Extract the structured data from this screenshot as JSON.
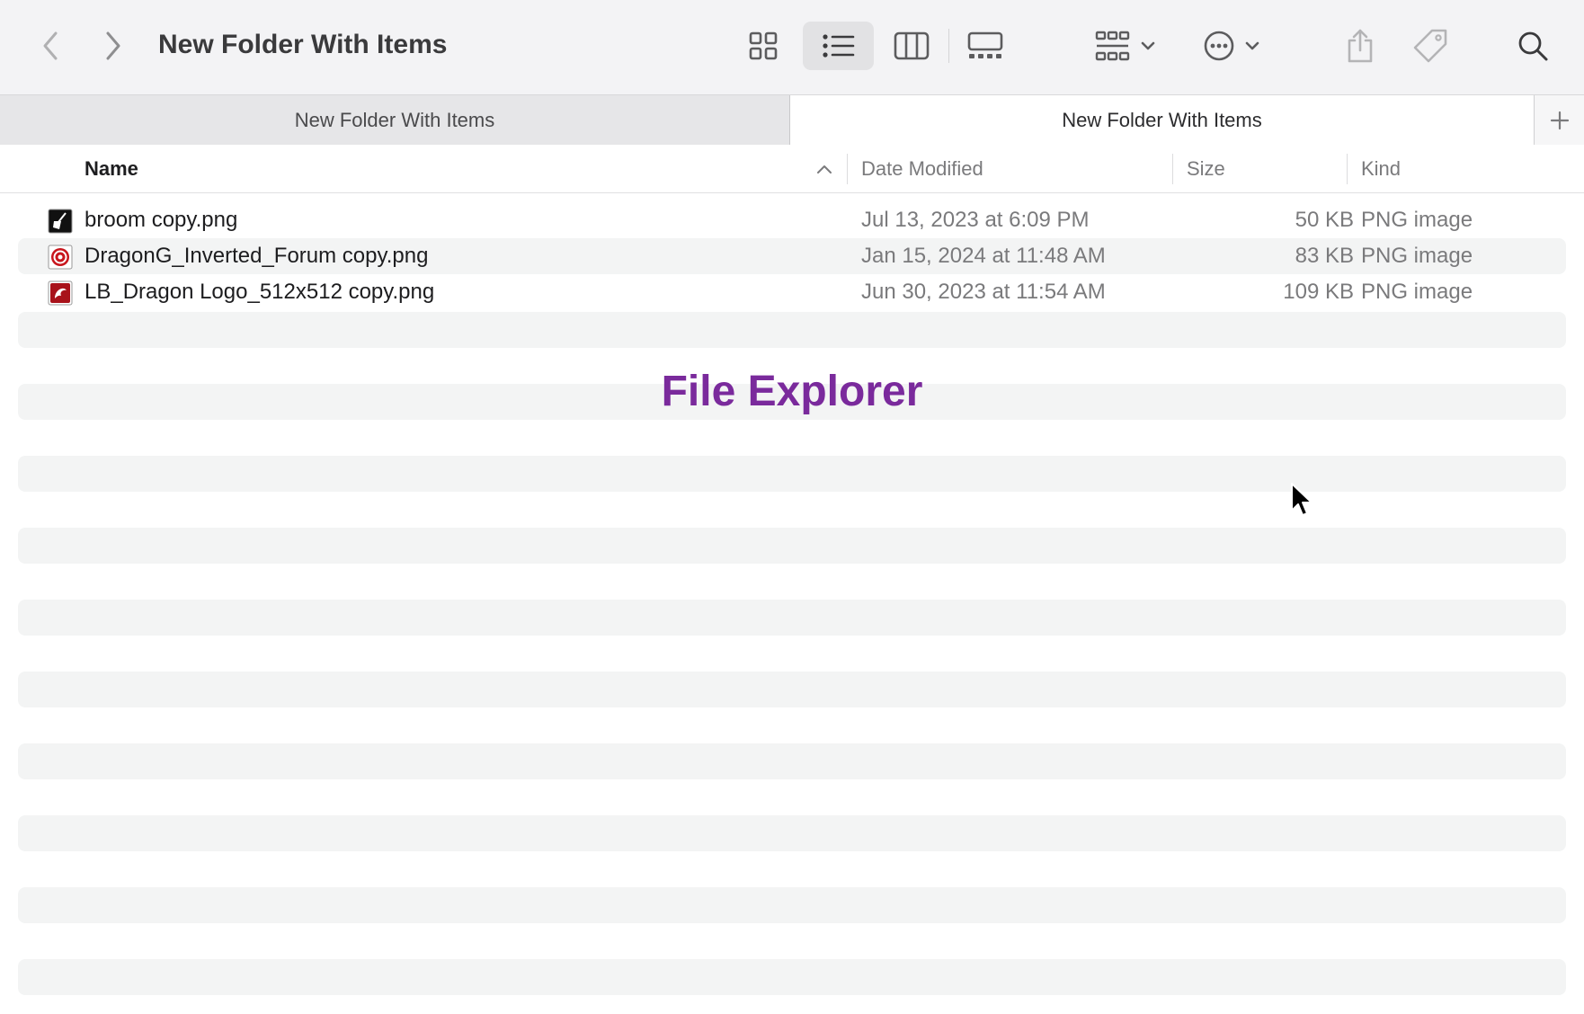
{
  "window": {
    "title": "New Folder With Items"
  },
  "toolbar": {
    "icons": [
      "chevron-left-icon",
      "chevron-right-icon",
      "grid-view-icon",
      "list-view-icon",
      "column-view-icon",
      "gallery-view-icon",
      "group-icon",
      "more-icon",
      "share-icon",
      "tag-icon",
      "search-icon"
    ],
    "selected_view": "list"
  },
  "tabs": [
    {
      "label": "New Folder With Items",
      "active": false
    },
    {
      "label": "New Folder With Items",
      "active": true
    }
  ],
  "columns": {
    "name": "Name",
    "date": "Date Modified",
    "size": "Size",
    "kind": "Kind"
  },
  "files": [
    {
      "name": "broom copy.png",
      "date": "Jul 13, 2023 at 6:09 PM",
      "size": "50 KB",
      "kind": "PNG image",
      "icon": "broom-thumbnail-icon"
    },
    {
      "name": "DragonG_Inverted_Forum copy.png",
      "date": "Jan 15, 2024 at 11:48 AM",
      "size": "83 KB",
      "kind": "PNG image",
      "icon": "dragon-logo-thumbnail-icon"
    },
    {
      "name": "LB_Dragon Logo_512x512 copy.png",
      "date": "Jun 30, 2023 at 11:54 AM",
      "size": "109 KB",
      "kind": "PNG image",
      "icon": "dragon-logo-thumbnail-icon"
    }
  ],
  "overlay": {
    "label": "File Explorer"
  },
  "colors": {
    "accent": "#7a2a9c",
    "stripe": "#f3f4f4",
    "toolbar": "#f3f3f5"
  }
}
